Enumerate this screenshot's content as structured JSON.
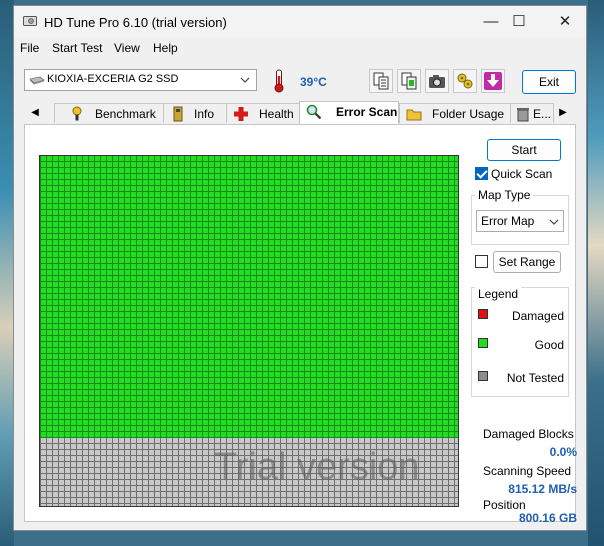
{
  "window": {
    "title": "HD Tune Pro 6.10 (trial version)",
    "controls": {
      "minimize": "—",
      "maximize": "☐",
      "close": "✕"
    }
  },
  "menu": [
    "File",
    "Start Test",
    "View",
    "Help"
  ],
  "toolbar": {
    "drive": "KIOXIA-EXCERIA G2 SSD",
    "temperature": "39°C",
    "exit_label": "Exit",
    "icons": [
      "copy-text-icon",
      "copy-screenshot-icon",
      "camera-icon",
      "tools-icon",
      "download-icon"
    ]
  },
  "tabs": {
    "scroll_left": "◀",
    "scroll_right": "▶",
    "items": [
      {
        "label": "Benchmark",
        "icon": "benchmark-icon"
      },
      {
        "label": "Info",
        "icon": "info-icon"
      },
      {
        "label": "Health",
        "icon": "health-icon"
      },
      {
        "label": "Error Scan",
        "icon": "magnifier-icon",
        "active": true
      },
      {
        "label": "Folder Usage",
        "icon": "folder-icon"
      },
      {
        "label": "E...",
        "icon": "trash-icon"
      }
    ]
  },
  "error_scan": {
    "start_label": "Start",
    "quick_scan_label": "Quick Scan",
    "quick_scan_checked": true,
    "map_type_title": "Map Type",
    "map_type_value": "Error Map",
    "set_range_label": "Set Range",
    "set_range_checked": false,
    "legend_title": "Legend",
    "legend": [
      {
        "label": "Damaged",
        "color": "#e01010"
      },
      {
        "label": "Good",
        "color": "#22dd22"
      },
      {
        "label": "Not Tested",
        "color": "#8c8c8c"
      }
    ],
    "progress_fraction": 0.8,
    "watermark": "Trial version",
    "stats": {
      "damaged_blocks_label": "Damaged Blocks",
      "damaged_blocks_value": "0.0%",
      "scanning_speed_label": "Scanning Speed",
      "scanning_speed_value": "815.12 MB/s",
      "position_label": "Position",
      "position_value": "800.16 GB"
    }
  }
}
